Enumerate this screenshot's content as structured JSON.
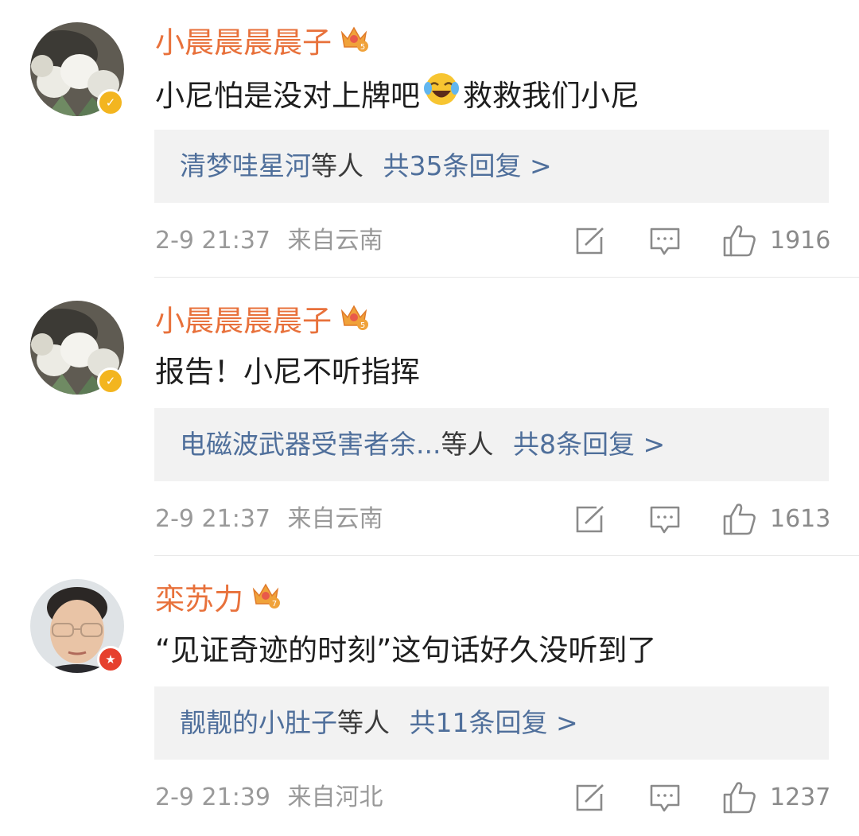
{
  "colors": {
    "username": "#e8713b",
    "link": "#4f6f9b",
    "reply_bg": "#f2f2f2",
    "meta": "#999999",
    "badge_gold": "#f3b51f",
    "badge_red": "#e6402d"
  },
  "comments": [
    {
      "username": "小晨晨晨晨子",
      "membership_level": "5",
      "verified_badge": "yellow-v-badge",
      "text_before_emoji": "小尼怕是没对上牌吧",
      "emoji": "laugh-cry-emoji",
      "text_after_emoji": "救救我们小尼",
      "replies": {
        "names": "清梦哇星河",
        "suffix": "等人",
        "count_label": "共35条回复 >"
      },
      "time": "2-9 21:37",
      "location": "来自云南",
      "likes": "1916"
    },
    {
      "username": "小晨晨晨晨子",
      "membership_level": "5",
      "verified_badge": "yellow-v-badge",
      "text_before_emoji": "报告！小尼不听指挥",
      "emoji": "",
      "text_after_emoji": "",
      "replies": {
        "names": "电磁波武器受害者余...",
        "suffix": "等人",
        "count_label": "共8条回复 >"
      },
      "time": "2-9 21:37",
      "location": "来自云南",
      "likes": "1613"
    },
    {
      "username": "栾苏力",
      "membership_level": "7",
      "verified_badge": "red-star-badge",
      "text_before_emoji": "“见证奇迹的时刻”这句话好久没听到了",
      "emoji": "",
      "text_after_emoji": "",
      "replies": {
        "names": "靓靓的小肚子",
        "suffix": "等人",
        "count_label": "共11条回复 >"
      },
      "time": "2-9 21:39",
      "location": "来自河北",
      "likes": "1237"
    }
  ]
}
